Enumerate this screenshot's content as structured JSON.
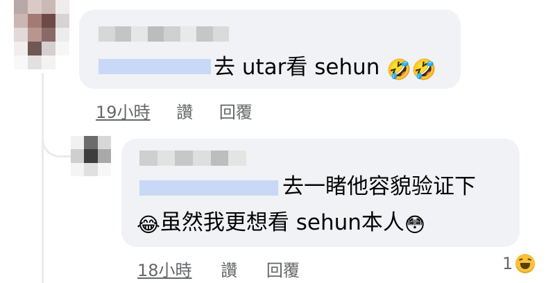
{
  "avatar_1_pixels": [
    "#b9a8a8",
    "#d9c9c7",
    "#cbb9b5",
    "#f0ecec",
    "#cbb6b4",
    "#a67a74",
    "#6d4a48",
    "#d8d2d2",
    "#e2d9d9",
    "#b99590",
    "#8a6a66",
    "#ececec",
    "#f2eeee",
    "#6f5754",
    "#d6cfcf",
    "#f6f6f6",
    "#f8f8f8",
    "#e3e0e0",
    "#f3f3f3",
    "#ffffff"
  ],
  "avatar_2_pixels": [
    "#f1f1f1",
    "#6c6c6c",
    "#d7d7d7",
    "#cfcfcf",
    "#3e3e3e",
    "#a9a9a9",
    "#f4f4f4",
    "#e0e0e0",
    "#f7f7f7"
  ],
  "name_1_pixels": [
    "#d7d7d7",
    "#c4c4c4",
    "#e6e6e6",
    "#bcbcbc",
    "#d0d0d0",
    "#e9e9e9",
    "#c6c6c6",
    "#dadada"
  ],
  "name_2_pixels": [
    "#cfcfcf",
    "#e2e2e2",
    "#c7c7c7",
    "#dedede",
    "#bdbdbd",
    "#e4e4e4"
  ],
  "comments": [
    {
      "text": "去 utar看 sehun",
      "emoji": "🤣🤣",
      "time": "19小時",
      "like": "讚",
      "reply": "回覆"
    },
    {
      "line1": "去一睹他容貌验证下",
      "emoji_leading": "😂",
      "line2": "虽然我更想看 sehun本人",
      "emoji_trailing": "😳",
      "time": "18小時",
      "like": "讚",
      "reply": "回覆",
      "reaction_count": "1",
      "reaction_icon": "haha-icon"
    }
  ]
}
